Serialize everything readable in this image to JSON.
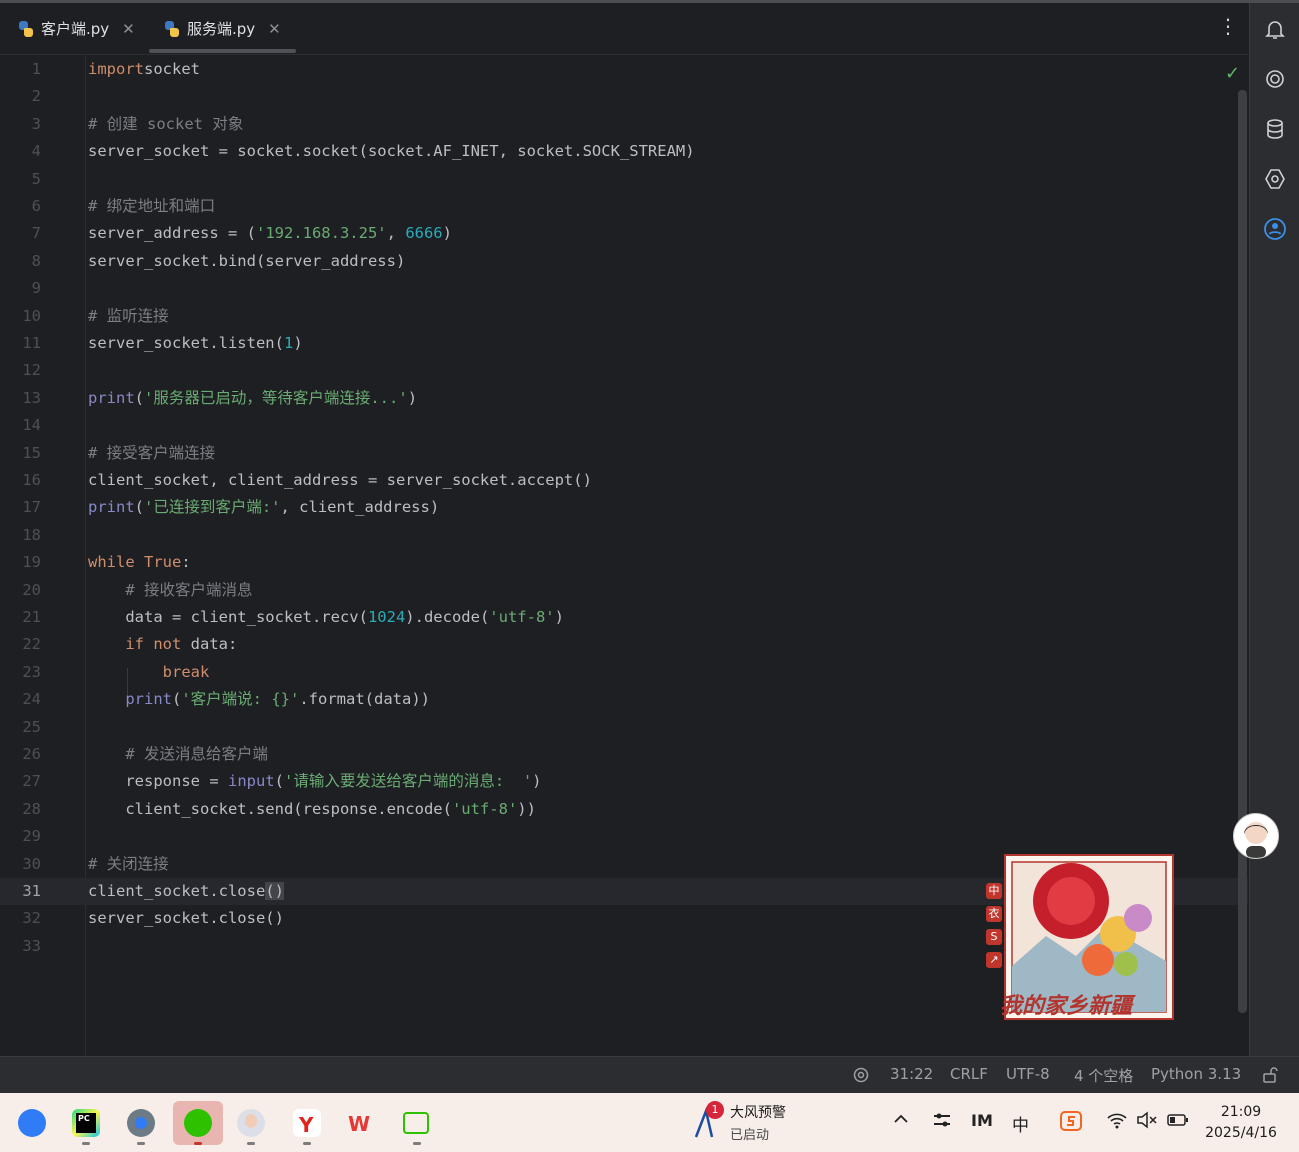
{
  "tabs": [
    {
      "label": "客户端.py",
      "active": false
    },
    {
      "label": "服务端.py",
      "active": true
    }
  ],
  "lines": [
    {
      "n": "1",
      "tokens": [
        [
          "kw",
          "import"
        ],
        [
          "",
          "socket"
        ]
      ]
    },
    {
      "n": "2",
      "tokens": []
    },
    {
      "n": "3",
      "tokens": [
        [
          "cm",
          "# 创建 socket 对象"
        ]
      ]
    },
    {
      "n": "4",
      "tokens": [
        [
          "",
          "server_socket = socket.socket(socket.AF_INET, socket.SOCK_STREAM)"
        ]
      ]
    },
    {
      "n": "5",
      "tokens": []
    },
    {
      "n": "6",
      "tokens": [
        [
          "cm",
          "# 绑定地址和端口"
        ]
      ]
    },
    {
      "n": "7",
      "tokens": [
        [
          "",
          "server_address = ("
        ],
        [
          "str",
          "'192.168.3.25'"
        ],
        [
          "",
          ", "
        ],
        [
          "num",
          "6666"
        ],
        [
          "",
          ")"
        ]
      ]
    },
    {
      "n": "8",
      "tokens": [
        [
          "",
          "server_socket.bind(server_address)"
        ]
      ]
    },
    {
      "n": "9",
      "tokens": []
    },
    {
      "n": "10",
      "tokens": [
        [
          "cm",
          "# 监听连接"
        ]
      ]
    },
    {
      "n": "11",
      "tokens": [
        [
          "",
          "server_socket.listen("
        ],
        [
          "num",
          "1"
        ],
        [
          "",
          ")"
        ]
      ]
    },
    {
      "n": "12",
      "tokens": []
    },
    {
      "n": "13",
      "tokens": [
        [
          "bi",
          "print"
        ],
        [
          "",
          "("
        ],
        [
          "str",
          "'服务器已启动，等待客户端连接...'"
        ],
        [
          "",
          ")"
        ]
      ]
    },
    {
      "n": "14",
      "tokens": []
    },
    {
      "n": "15",
      "tokens": [
        [
          "cm",
          "# 接受客户端连接"
        ]
      ]
    },
    {
      "n": "16",
      "tokens": [
        [
          "",
          "client_socket, client_address = server_socket.accept()"
        ]
      ]
    },
    {
      "n": "17",
      "tokens": [
        [
          "bi",
          "print"
        ],
        [
          "",
          "("
        ],
        [
          "str",
          "'已连接到客户端:'"
        ],
        [
          "",
          ", client_address)"
        ]
      ]
    },
    {
      "n": "18",
      "tokens": []
    },
    {
      "n": "19",
      "tokens": [
        [
          "kw",
          "while"
        ],
        [
          "",
          " "
        ],
        [
          "kw",
          "True"
        ],
        [
          "",
          ":"
        ]
      ]
    },
    {
      "n": "20",
      "tokens": [
        [
          "",
          "    "
        ],
        [
          "cm",
          "# 接收客户端消息"
        ]
      ]
    },
    {
      "n": "21",
      "tokens": [
        [
          "",
          "    data = client_socket.recv("
        ],
        [
          "num",
          "1024"
        ],
        [
          "",
          ").decode("
        ],
        [
          "str",
          "'utf-8'"
        ],
        [
          "",
          ")"
        ]
      ]
    },
    {
      "n": "22",
      "tokens": [
        [
          "",
          "    "
        ],
        [
          "kw",
          "if not"
        ],
        [
          "",
          " data:"
        ]
      ]
    },
    {
      "n": "23",
      "tokens": [
        [
          "",
          "        "
        ],
        [
          "kw",
          "break"
        ]
      ]
    },
    {
      "n": "24",
      "tokens": [
        [
          "",
          "    "
        ],
        [
          "bi",
          "print"
        ],
        [
          "",
          "("
        ],
        [
          "str",
          "'客户端说: {}'"
        ],
        [
          "",
          ".format(data))"
        ]
      ]
    },
    {
      "n": "25",
      "tokens": []
    },
    {
      "n": "26",
      "tokens": [
        [
          "",
          "    "
        ],
        [
          "cm",
          "# 发送消息给客户端"
        ]
      ]
    },
    {
      "n": "27",
      "tokens": [
        [
          "",
          "    response = "
        ],
        [
          "bi",
          "input"
        ],
        [
          "",
          "("
        ],
        [
          "str",
          "'请输入要发送给客户端的消息:  '"
        ],
        [
          "",
          ")"
        ]
      ]
    },
    {
      "n": "28",
      "tokens": [
        [
          "",
          "    client_socket.send(response.encode("
        ],
        [
          "str",
          "'utf-8'"
        ],
        [
          "",
          "))"
        ]
      ]
    },
    {
      "n": "29",
      "tokens": []
    },
    {
      "n": "30",
      "tokens": [
        [
          "cm",
          "# 关闭连接"
        ]
      ]
    },
    {
      "n": "31",
      "tokens": [
        [
          "",
          "client_socket.close"
        ],
        [
          "hl",
          "()"
        ]
      ],
      "current": true
    },
    {
      "n": "32",
      "tokens": [
        [
          "",
          "server_socket.close()"
        ]
      ]
    },
    {
      "n": "33",
      "tokens": []
    }
  ],
  "right_toolbar": [
    "bell-icon",
    "ai-assistant-icon",
    "database-icon",
    "plugin-icon",
    "account-icon"
  ],
  "status_bar": {
    "position": "31:22",
    "line_separator": "CRLF",
    "encoding": "UTF-8",
    "indent": "4 个空格",
    "interpreter": "Python 3.13"
  },
  "sticker": {
    "caption": "我的家乡新疆",
    "side_labels": [
      "中",
      "衣",
      "S",
      "↗"
    ]
  },
  "taskbar": {
    "apps": [
      "cloud-app",
      "pycharm-app",
      "settings-app",
      "wechat-app",
      "avatar-app",
      "yandex-app",
      "wps-app",
      "remote-app"
    ],
    "active_app": "wechat-app",
    "weather": {
      "badge": "1",
      "title": "大风预警",
      "subtitle": "已启动"
    },
    "ime": "中",
    "time": "21:09",
    "date": "2025/4/16"
  },
  "colors": {
    "editor_bg": "#1e1f22",
    "keyword": "#cf8e6d",
    "string": "#6aab73",
    "number": "#2aacb8",
    "comment": "#7a7e85",
    "builtin": "#8888c6",
    "text": "#bcbec4"
  }
}
